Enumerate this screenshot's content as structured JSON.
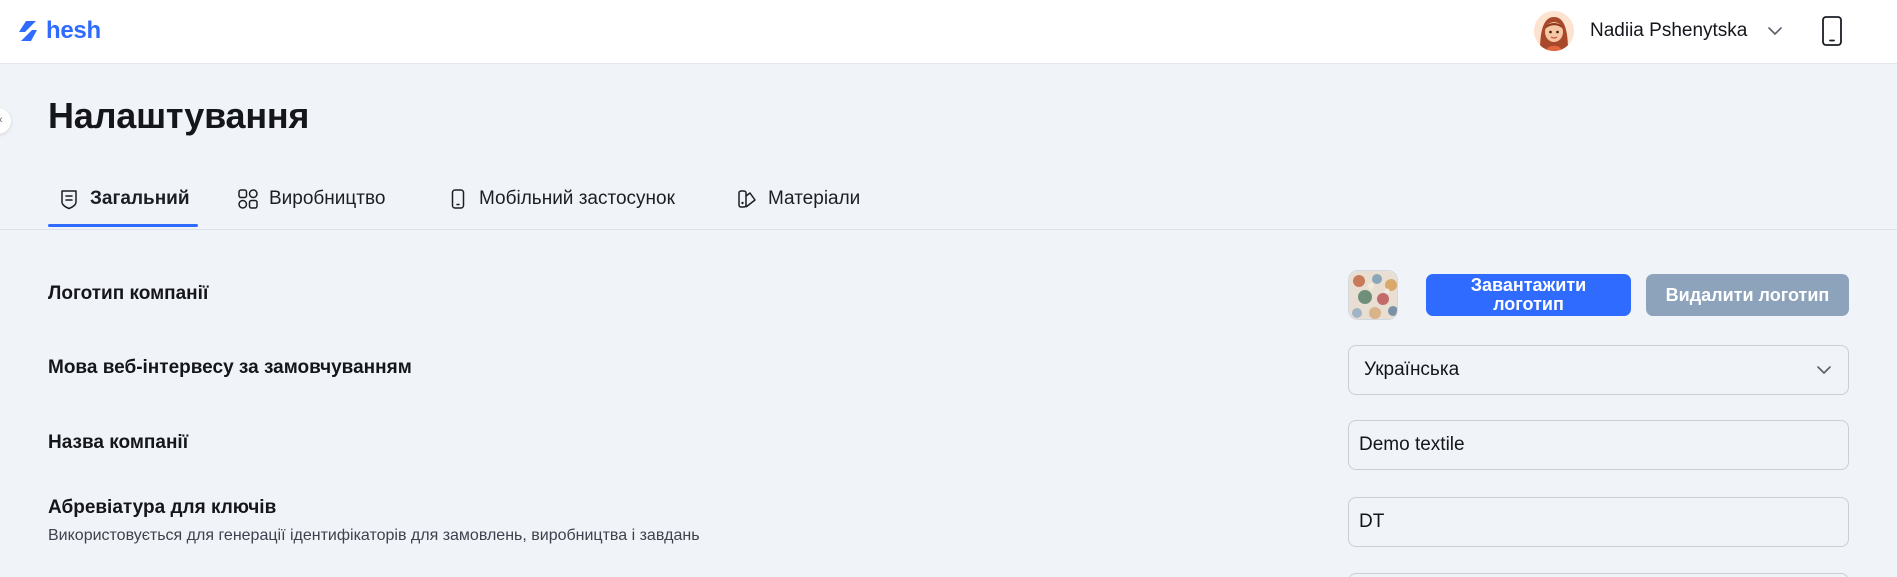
{
  "brand": {
    "name": "hesh",
    "color": "#2f6bff"
  },
  "header": {
    "user_name": "Nadiia Pshenytska",
    "avatar_icon": "user-avatar",
    "phone_icon": "mobile-phone-icon"
  },
  "page": {
    "title": "Налаштування"
  },
  "tabs": [
    {
      "label": "Загальний",
      "icon": "shield-document-icon",
      "active": true
    },
    {
      "label": "Виробництво",
      "icon": "production-icon",
      "active": false
    },
    {
      "label": "Мобільний застосунок",
      "icon": "mobile-icon",
      "active": false
    },
    {
      "label": "Матеріали",
      "icon": "materials-icon",
      "active": false
    }
  ],
  "settings": {
    "logo": {
      "label": "Логотип компанії",
      "upload_label": "Завантажити логотип",
      "delete_label": "Видалити логотип"
    },
    "language": {
      "label": "Мова веб-інтервесу за замовчуванням",
      "value": "Українська"
    },
    "company_name": {
      "label": "Назва компанії",
      "value": "Demo textile"
    },
    "abbreviation": {
      "label": "Абревіатура для ключів",
      "description": "Використовується для генерації ідентифікаторів для замовлень, виробництва і завдань",
      "value": "DT"
    }
  },
  "colors": {
    "accent": "#2f6bff",
    "delete_button": "#8ca3bb",
    "background": "#f0f3f7"
  }
}
